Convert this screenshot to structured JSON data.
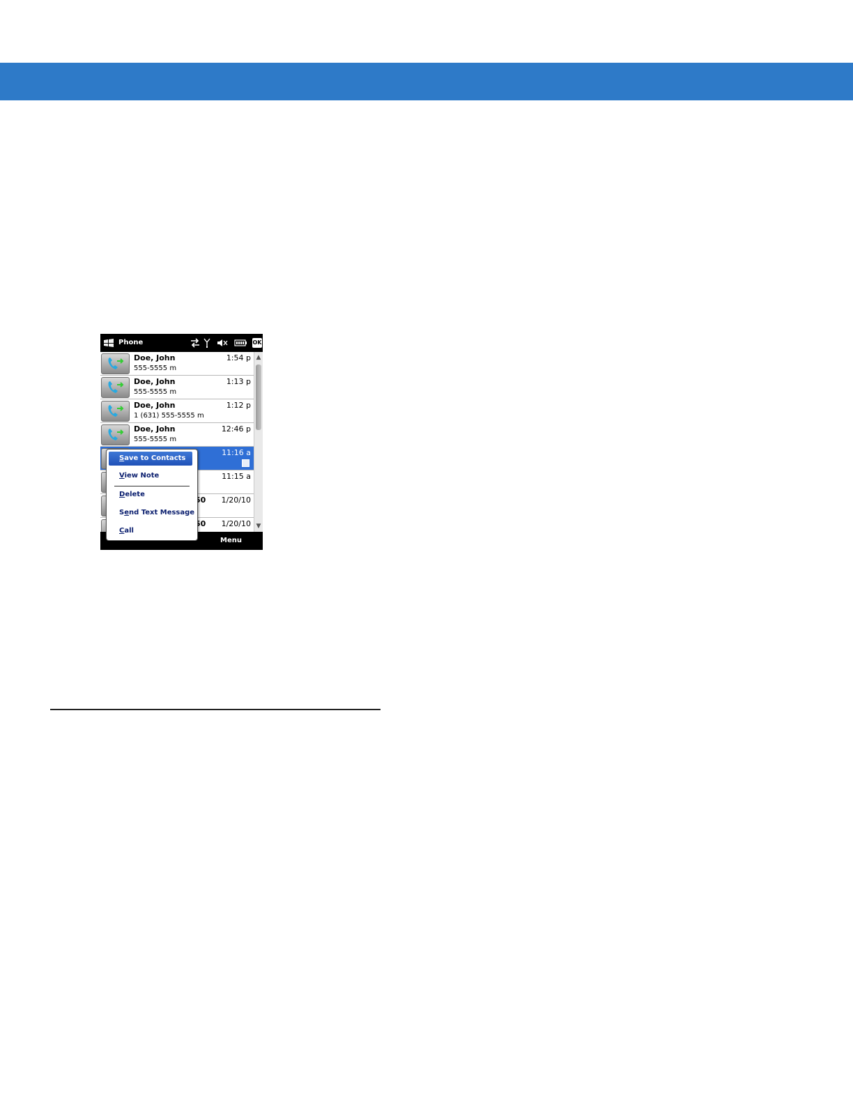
{
  "app": {
    "title": "Phone"
  },
  "status_icons": [
    "data-sync-icon",
    "signal-antenna-icon",
    "speaker-muted-icon",
    "battery-icon"
  ],
  "ok_button": "OK",
  "call_log": [
    {
      "name": "Doe, John",
      "number": "555-5555",
      "type": "m",
      "time": "1:54 p"
    },
    {
      "name": "Doe, John",
      "number": "555-5555",
      "type": "m",
      "time": "1:13 p"
    },
    {
      "name": "Doe, John",
      "number": "1 (631) 555-5555",
      "type": "m",
      "time": "1:12 p"
    },
    {
      "name": "Doe, John",
      "number": "555-5555",
      "type": "m",
      "time": "12:46 p"
    },
    {
      "name": "",
      "number": "",
      "type": "",
      "time": "11:16 a",
      "selected": true,
      "has_note": true
    },
    {
      "name": "",
      "number": "",
      "type": "",
      "time": "11:15 a"
    },
    {
      "name": "50",
      "number": "",
      "type": "",
      "time": "1/20/10"
    },
    {
      "name": "50",
      "number": "",
      "type": "",
      "time": "1/20/10"
    }
  ],
  "context_menu": {
    "items": [
      {
        "first": "S",
        "rest": "ave to Contacts"
      },
      {
        "first": "V",
        "rest": "iew Note"
      },
      {
        "first": "D",
        "rest": "elete"
      },
      {
        "first": "S",
        "u": "e",
        "rest": "nd Text Message"
      },
      {
        "first": "C",
        "rest": "all"
      }
    ]
  },
  "softkeys": {
    "right": "Menu"
  },
  "colors": {
    "header_band": "#2e7ac8",
    "selected_row": "#2f6fd6",
    "menu_text": "#0a1e6e"
  }
}
